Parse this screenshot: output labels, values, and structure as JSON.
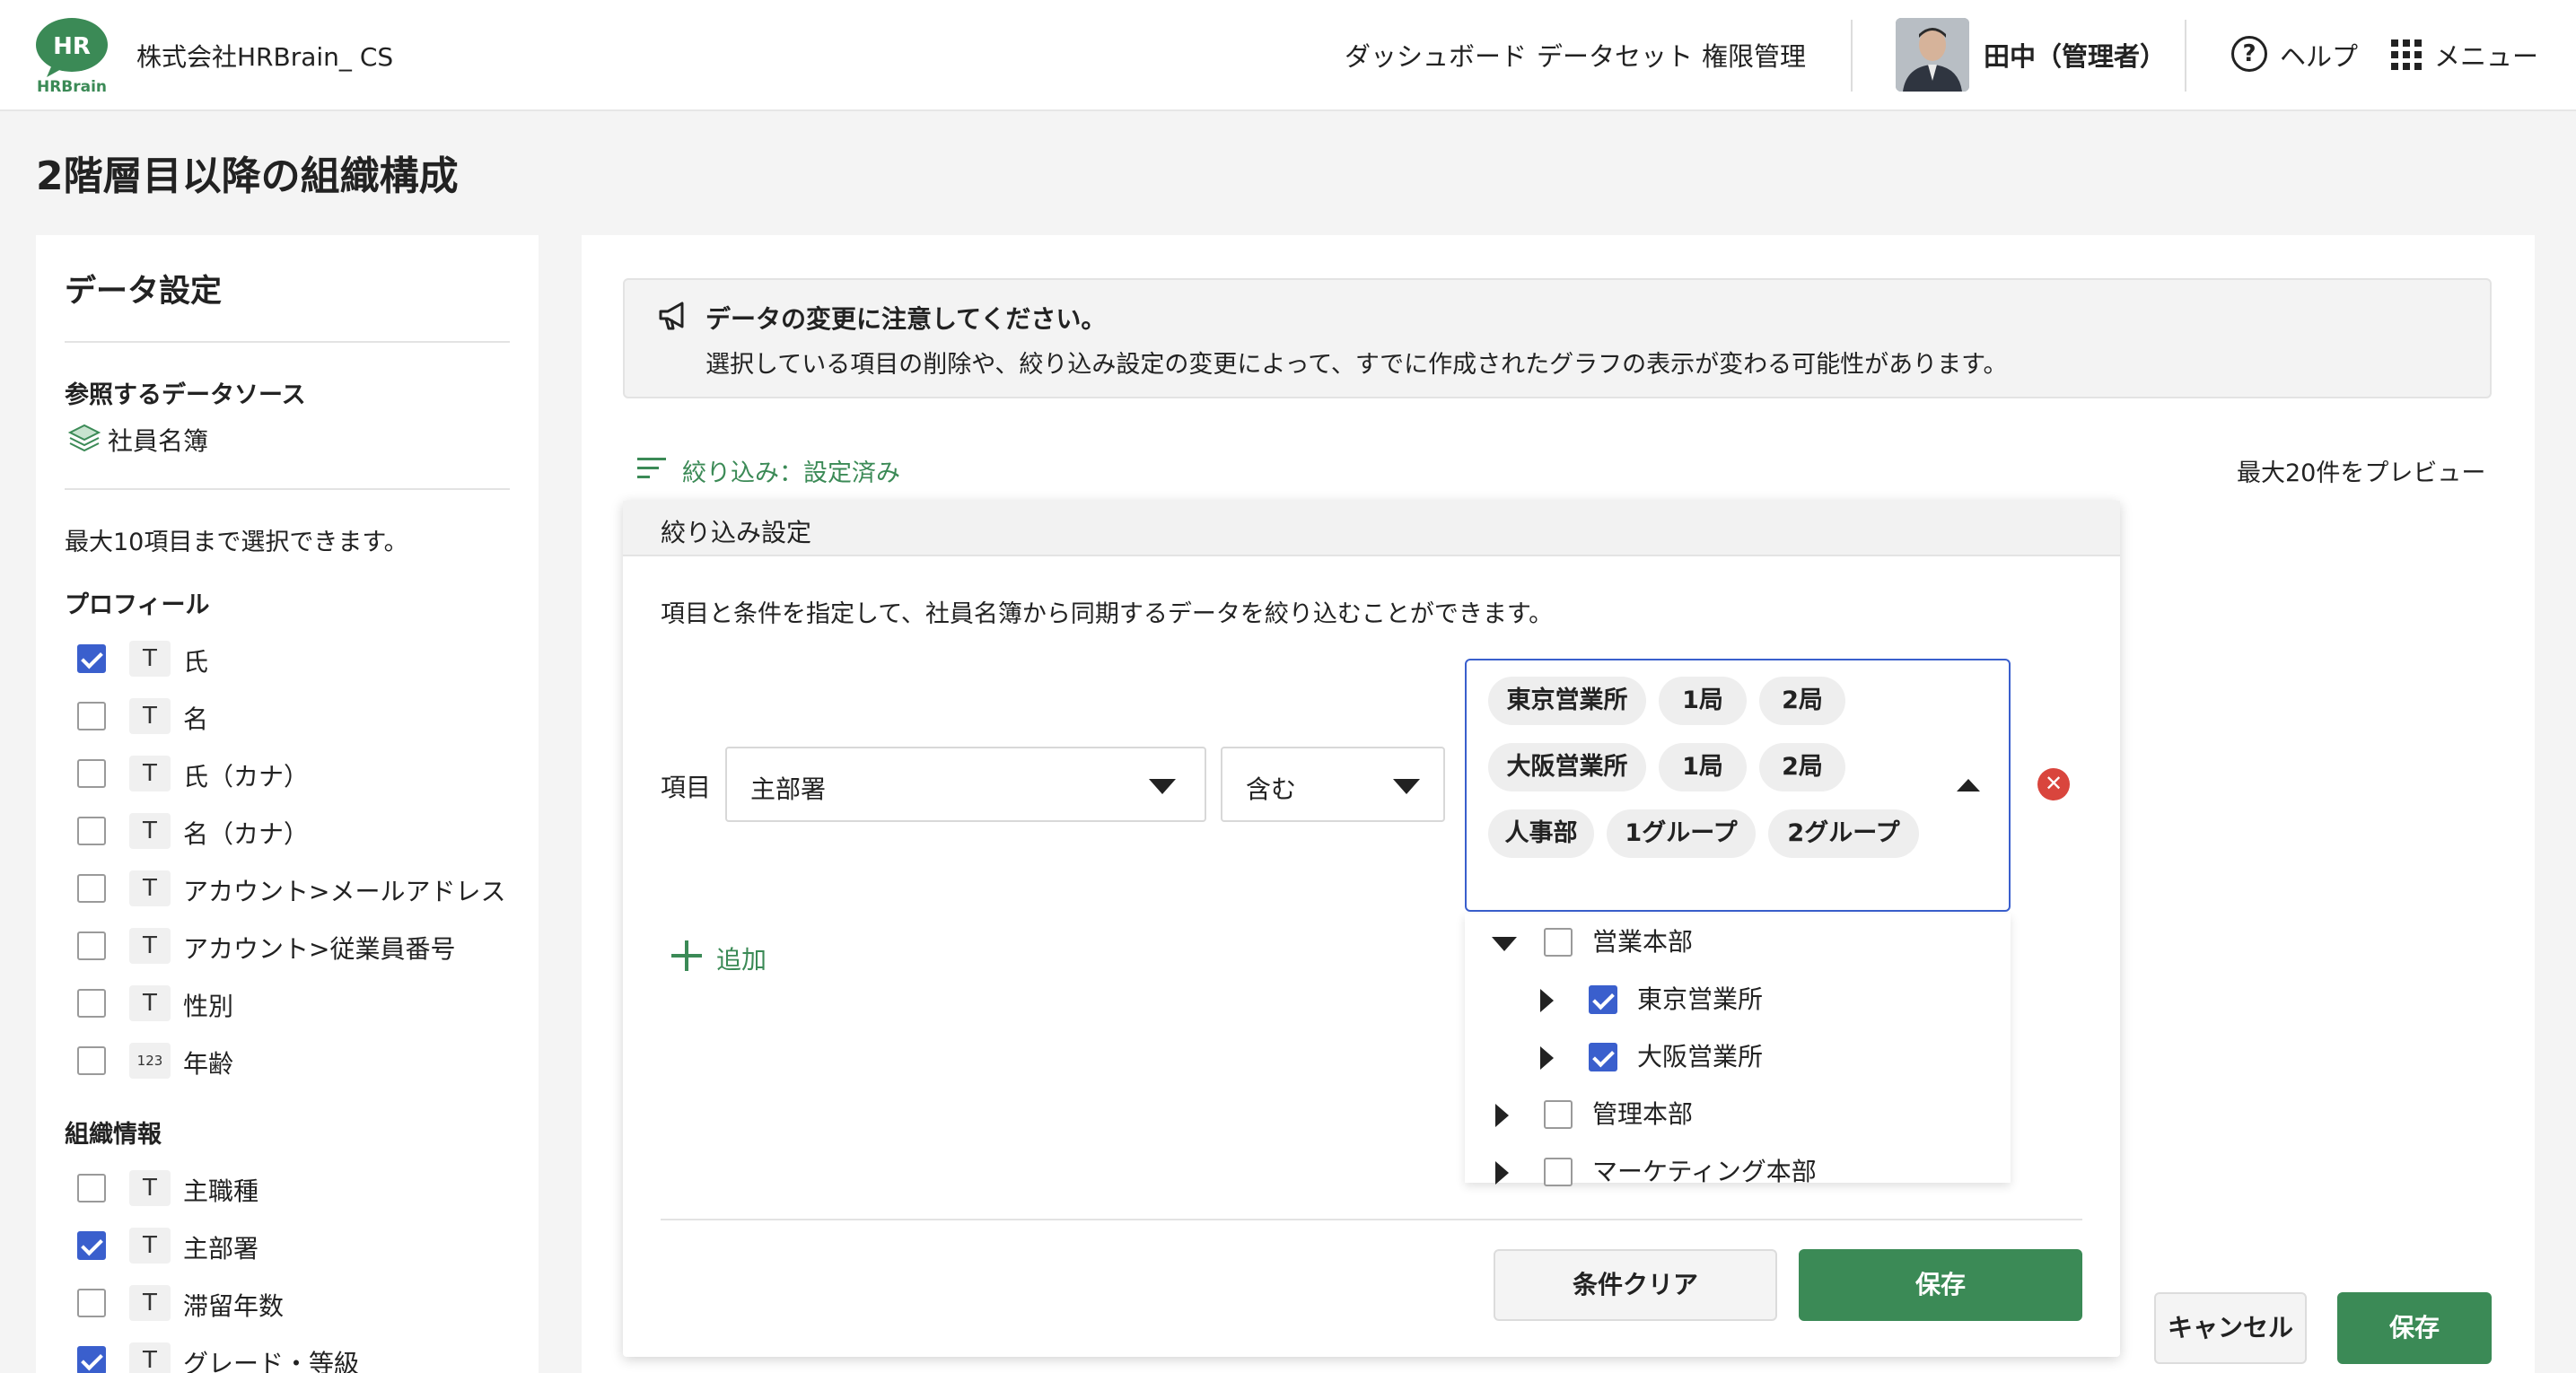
{
  "header": {
    "logo_text": "HR",
    "logo_sub": "HRBrain",
    "company": "株式会社HRBrain_ CS",
    "nav": [
      "ダッシュボード",
      "データセット",
      "権限管理"
    ],
    "user": "田中（管理者）",
    "help": "ヘルプ",
    "menu": "メニュー"
  },
  "page": {
    "title": "2階層目以降の組織構成"
  },
  "left": {
    "title": "データ設定",
    "source_label": "参照するデータソース",
    "source_name": "社員名簿",
    "limit_note": "最大10項目まで選択できます。",
    "groups": [
      {
        "label": "プロフィール",
        "fields": [
          {
            "type": "T",
            "name": "氏",
            "checked": true
          },
          {
            "type": "T",
            "name": "名",
            "checked": false
          },
          {
            "type": "T",
            "name": "氏（カナ）",
            "checked": false
          },
          {
            "type": "T",
            "name": "名（カナ）",
            "checked": false
          },
          {
            "type": "T",
            "name": "アカウント>メールアドレス",
            "checked": false
          },
          {
            "type": "T",
            "name": "アカウント>従業員番号",
            "checked": false
          },
          {
            "type": "T",
            "name": "性別",
            "checked": false
          },
          {
            "type": "123",
            "name": "年齢",
            "checked": false
          }
        ]
      },
      {
        "label": "組織情報",
        "fields": [
          {
            "type": "T",
            "name": "主職種",
            "checked": false
          },
          {
            "type": "T",
            "name": "主部署",
            "checked": true
          },
          {
            "type": "T",
            "name": "滞留年数",
            "checked": false
          },
          {
            "type": "T",
            "name": "グレード・等級",
            "checked": true
          }
        ]
      }
    ]
  },
  "notice": {
    "title": "データの変更に注意してください。",
    "body": "選択している項目の削除や、絞り込み設定の変更によって、すでに作成されたグラフの表示が変わる可能性があります。"
  },
  "filter": {
    "link": "絞り込み：設定済み",
    "preview": "最大20件をプレビュー",
    "popover_title": "絞り込み設定",
    "description": "項目と条件を指定して、社員名簿から同期するデータを絞り込むことができます。",
    "item_label": "項目",
    "item_value": "主部署",
    "condition_value": "含む",
    "chips": [
      [
        "東京営業所",
        "1局",
        "2局"
      ],
      [
        "大阪営業所",
        "1局",
        "2局"
      ],
      [
        "人事部",
        "1グループ",
        "2グループ"
      ]
    ],
    "add_label": "追加",
    "tree": [
      {
        "label": "営業本部",
        "level": 0,
        "expanded": true,
        "checked": false
      },
      {
        "label": "東京営業所",
        "level": 1,
        "expanded": false,
        "checked": true
      },
      {
        "label": "大阪営業所",
        "level": 1,
        "expanded": false,
        "checked": true
      },
      {
        "label": "管理本部",
        "level": 0,
        "expanded": false,
        "checked": false
      },
      {
        "label": "マーケティング本部",
        "level": 0,
        "expanded": false,
        "checked": false
      }
    ],
    "clear_button": "条件クリア",
    "save_button": "保存"
  },
  "footer": {
    "cancel": "キャンセル",
    "save": "保存"
  },
  "colors": {
    "brand_green": "#3b8a56",
    "check_blue": "#3a5fcd",
    "danger_red": "#d9453d"
  }
}
